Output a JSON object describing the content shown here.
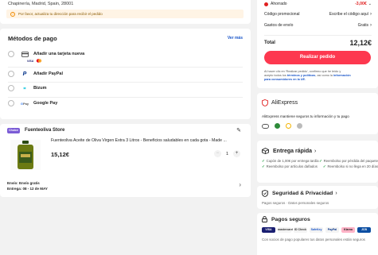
{
  "address": {
    "line": "Chapinería, Madrid, Spain, 28001",
    "notice": "Por favor, actualiza tu dirección para recibir el pedido"
  },
  "payment": {
    "title": "Métodos de pago",
    "more": "Ver más",
    "methods": [
      {
        "label": "Añadir una tarjeta nueva",
        "icon": "credit-card-icon"
      },
      {
        "label": "Añadir PayPal",
        "icon": "paypal-icon"
      },
      {
        "label": "Bizum",
        "icon": "bizum-icon"
      },
      {
        "label": "Google Pay",
        "icon": "google-pay-icon"
      }
    ],
    "card_brands": [
      "VISA",
      "mastercard"
    ]
  },
  "store": {
    "badge": "Choice",
    "name": "Fuenteoliva Store",
    "product_title": "Fuenteoliva Aceite de Oliva Virgen Extra 3 Litros - Beneficios saludables en cada gota - Made ...",
    "price": "15,12€",
    "quantity": "1",
    "shipping_line1": "Envío: Envío gratis",
    "shipping_line2": "Entrega: 08 - 12 de MAY",
    "colors": {
      "badge_bg": "#7b5cd6"
    }
  },
  "summary": {
    "saved_label": "Ahorrado",
    "saved_value": "-3,00€",
    "promo_label": "Código promocional",
    "promo_action": "Escribe el código aquí",
    "shipping_label": "Gastos de envío",
    "shipping_value": "Gratis",
    "total_label": "Total",
    "total_value": "12,12€",
    "cta": "Realizar pedido",
    "legal_1": "Al hacer clic en 'Realizar pedido', confirmo que he leído y",
    "legal_2a": "acepto todos los ",
    "legal_terms": "términos y políticas",
    "legal_2b": ", así como la ",
    "legal_info": "información",
    "legal_3": "para consumidores en la UE.",
    "colors": {
      "accent": "#fd384f",
      "saved": "#e02020",
      "link": "#1a56c9"
    }
  },
  "aliexpress": {
    "brand": "AliExpress",
    "text": "AliExpress mantiene seguros tu información y tu pago",
    "badges": [
      "certificado",
      "verificado",
      "norton",
      "seguro"
    ]
  },
  "delivery": {
    "title": "Entrega rápida",
    "items": [
      "Cupón de 1,00€ por entrega tardía",
      "Reembolso por pérdida del paquete",
      "Reembolso por artículos dañados",
      "Reembolso si no llega en 20 días"
    ]
  },
  "privacy": {
    "title": "Seguridad & Privacidad",
    "sub": "Pagos seguros · Datos personales seguros"
  },
  "secure_pay": {
    "title": "Pagos seguros",
    "logos": [
      "VISA",
      "mastercard",
      "ID Check",
      "SafeKey",
      "PayPal",
      "Klarna",
      "JCB"
    ],
    "text": "Con socios de pago populares tus datos personales están seguros"
  }
}
